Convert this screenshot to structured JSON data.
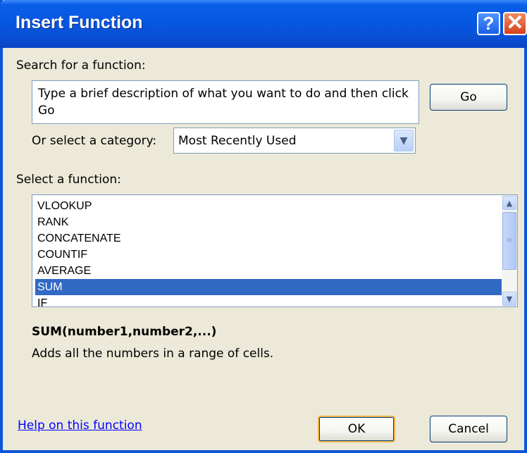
{
  "window": {
    "title": "Insert Function",
    "help_button": "?",
    "close_button": "✕"
  },
  "search": {
    "label": "Search for a function:",
    "value": "Type a brief description of what you want to do and then click Go",
    "go_label": "Go"
  },
  "category": {
    "label": "Or select a category:",
    "selected": "Most Recently Used"
  },
  "functions": {
    "label": "Select a function:",
    "items": [
      {
        "label": "VLOOKUP"
      },
      {
        "label": "RANK"
      },
      {
        "label": "CONCATENATE"
      },
      {
        "label": "COUNTIF"
      },
      {
        "label": "AVERAGE"
      },
      {
        "label": "SUM"
      },
      {
        "label": "IF"
      }
    ],
    "selected_index": 5
  },
  "details": {
    "signature": "SUM(number1,number2,...)",
    "description": "Adds all the numbers in a range of cells."
  },
  "footer": {
    "help_link": "Help on this function",
    "ok_label": "OK",
    "cancel_label": "Cancel"
  },
  "colors": {
    "titlebar": "#0656e0",
    "selection": "#316ac5",
    "dialog_bg": "#ece9d8",
    "link": "#0000ff"
  }
}
